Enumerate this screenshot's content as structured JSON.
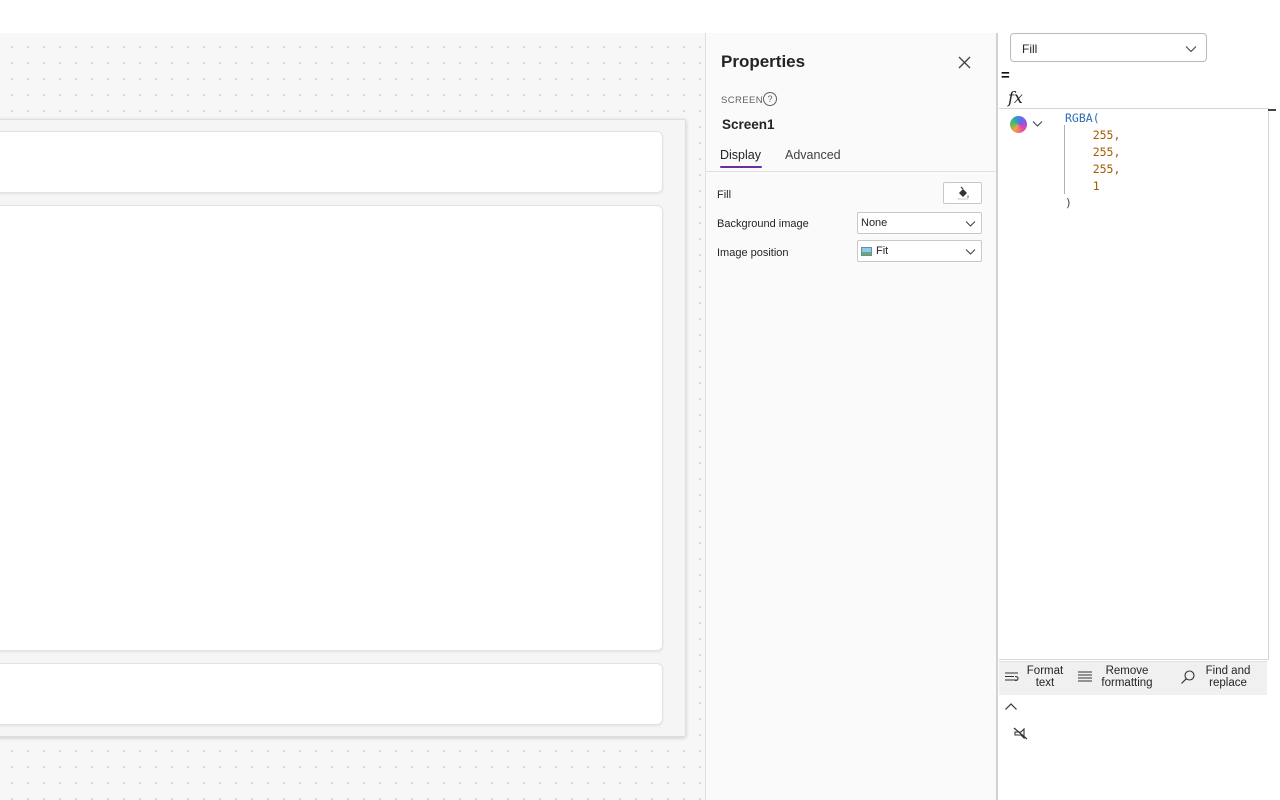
{
  "properties_panel": {
    "title": "Properties",
    "screen_kind": "SCREEN",
    "help_glyph": "?",
    "screen_name": "Screen1",
    "tabs": [
      {
        "label": "Display",
        "active": true
      },
      {
        "label": "Advanced",
        "active": false
      }
    ],
    "rows": {
      "fill_label": "Fill",
      "background_image_label": "Background image",
      "background_image_value": "None",
      "image_position_label": "Image position",
      "image_position_value": "Fit"
    }
  },
  "formula_bar": {
    "selected_property": "Fill",
    "equals": "=",
    "fx": "fx",
    "code": {
      "function": "RGBA(",
      "args": [
        "255,",
        "255,",
        "255,",
        "1"
      ],
      "close": ")"
    },
    "toolbar": {
      "format_text": "Format text",
      "remove_formatting": "Remove formatting",
      "find_and_replace": "Find and replace"
    }
  },
  "colors": {
    "accent_tab_underline": "#6b2fa3",
    "code_function": "#2f6db5",
    "code_number": "#a15b00"
  },
  "icons": [
    "close-icon",
    "help-icon",
    "paint-bucket-icon",
    "chevron-down-icon",
    "image-icon",
    "copilot-icon",
    "format-text-icon",
    "remove-formatting-icon",
    "search-icon",
    "chevron-up-icon",
    "unpin-icon"
  ]
}
